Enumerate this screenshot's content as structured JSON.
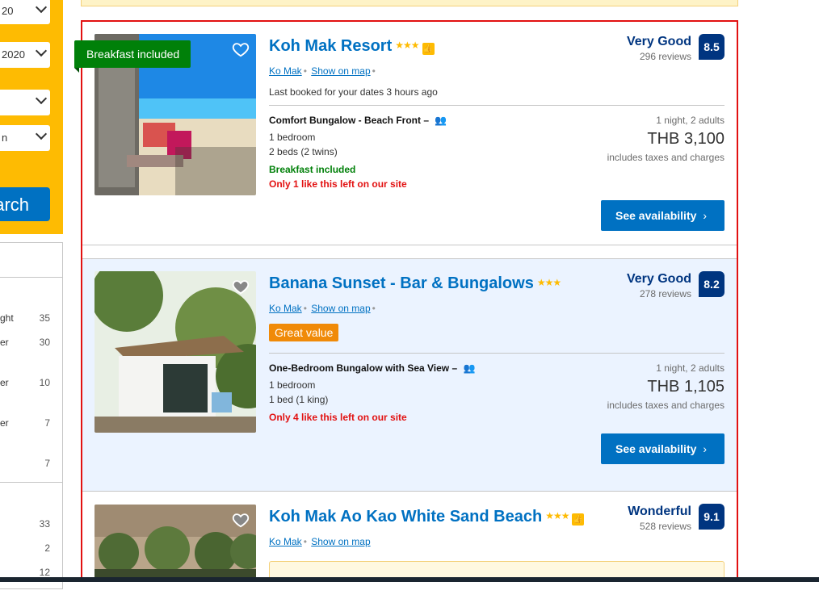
{
  "search": {
    "dropdowns": [
      {
        "value": "20"
      },
      {
        "value": "2020"
      },
      {
        "value": ""
      },
      {
        "value": "n"
      }
    ],
    "search_label": "arch"
  },
  "filters": {
    "rows": [
      {
        "label": "ght",
        "count": "35"
      },
      {
        "label": "er",
        "count": "30"
      },
      {
        "label": "er",
        "count": "10"
      },
      {
        "label": "er",
        "count": "7"
      },
      {
        "label": "",
        "count": "7"
      },
      {
        "label": "",
        "count": "33"
      },
      {
        "label": "",
        "count": "2"
      },
      {
        "label": "",
        "count": "12"
      }
    ]
  },
  "results": [
    {
      "name": "Koh Mak Resort",
      "stars": "★★★",
      "preferred": true,
      "ribbon": "Breakfast included",
      "location": "Ko Mak",
      "show_on_map": "Show on map",
      "last_booked": "Last booked for your dates 3 hours ago",
      "room_name": "Comfort Bungalow - Beach Front",
      "room_detail_1": "1 bedroom",
      "room_detail_2": "2 beds (2 twins)",
      "breakfast": "Breakfast included",
      "scarcity": "Only 1 like this left on our site",
      "score_word": "Very Good",
      "reviews": "296 reviews",
      "score": "8.5",
      "nights": "1 night, 2 adults",
      "price": "THB 3,100",
      "taxes": "includes taxes and charges",
      "cta": "See availability"
    },
    {
      "name": "Banana Sunset - Bar & Bungalows",
      "stars": "★★★",
      "preferred": false,
      "location": "Ko Mak",
      "show_on_map": "Show on map",
      "badge": "Great value",
      "room_name": "One-Bedroom Bungalow with Sea View",
      "room_detail_1": "1 bedroom",
      "room_detail_2": "1 bed (1 king)",
      "scarcity": "Only 4 like this left on our site",
      "score_word": "Very Good",
      "reviews": "278 reviews",
      "score": "8.2",
      "nights": "1 night, 2 adults",
      "price": "THB 1,105",
      "taxes": "includes taxes and charges",
      "cta": "See availability"
    },
    {
      "name": "Koh Mak Ao Kao White Sand Beach",
      "stars": "★★★",
      "preferred": true,
      "location": "Ko Mak",
      "show_on_map": "Show on map",
      "score_word": "Wonderful",
      "reviews": "528 reviews",
      "score": "9.1"
    }
  ],
  "colors": {
    "brand_blue": "#0071c2",
    "dark_blue": "#003580",
    "yellow": "#febb02",
    "green": "#008009",
    "red": "#e21111",
    "orange": "#f08a08",
    "highlight_bg": "#ebf3ff"
  },
  "icons": {
    "favorite": "heart-icon",
    "people": "two-person-icon",
    "preferred": "thumbs-up-icon",
    "chevron": "chevron-right-icon"
  }
}
